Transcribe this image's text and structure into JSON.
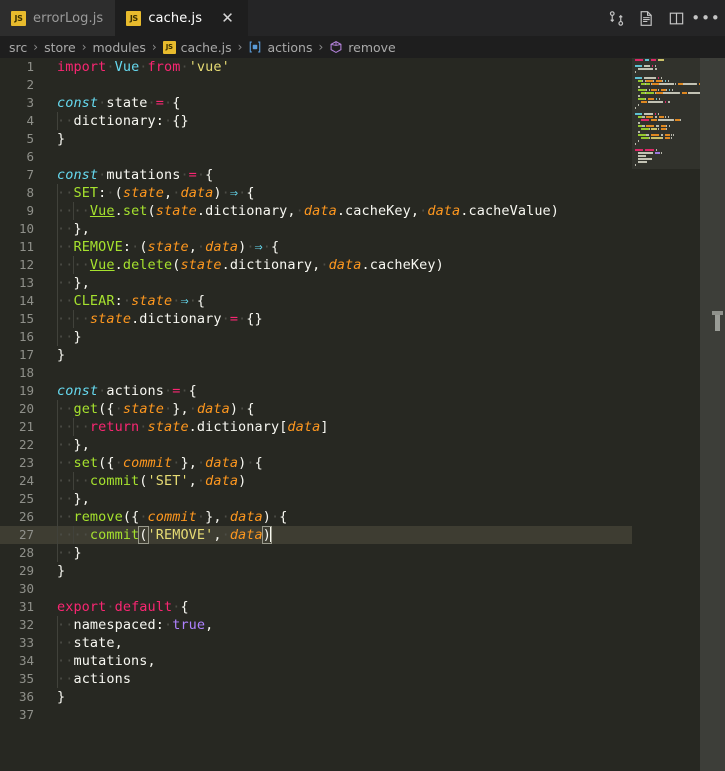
{
  "window": {
    "app": "Visual Studio Code",
    "theme": "Monokai Dark"
  },
  "tabbar": {
    "tabs": [
      {
        "label": "errorLog.js",
        "icon": "js-file-icon",
        "badge": "JS",
        "active": false,
        "closable": false
      },
      {
        "label": "cache.js",
        "icon": "js-file-icon",
        "badge": "JS",
        "active": true,
        "closable": true,
        "close_label": "✕"
      }
    ],
    "actions": [
      {
        "name": "split-diff-icon",
        "title": "Compare Changes"
      },
      {
        "name": "open-preview-icon",
        "title": "Open Preview"
      },
      {
        "name": "split-editor-icon",
        "title": "Split Editor Right"
      },
      {
        "name": "more-actions-icon",
        "title": "More Actions...",
        "glyph": "•••"
      }
    ]
  },
  "breadcrumbs": {
    "separator": "›",
    "items": [
      {
        "label": "src",
        "icon": "none"
      },
      {
        "label": "store",
        "icon": "none"
      },
      {
        "label": "modules",
        "icon": "none"
      },
      {
        "label": "cache.js",
        "icon": "js-file-icon",
        "badge": "JS"
      },
      {
        "label": "actions",
        "icon": "symbol-variable-icon"
      },
      {
        "label": "remove",
        "icon": "symbol-method-icon"
      }
    ]
  },
  "editor": {
    "language": "javascript",
    "active_line": 27,
    "cursor": {
      "line": 27,
      "column": 27
    },
    "total_lines": 37,
    "colors": {
      "background": "#272822",
      "active_line": "#3e3d32",
      "line_number": "#8f908a",
      "keyword": "#f92672",
      "string": "#e6db74",
      "function": "#a6e22e",
      "parameter": "#fd971f",
      "constant": "#66d9ef",
      "number": "#ae81ff",
      "text": "#f8f8f2"
    },
    "lines": [
      {
        "n": 1,
        "tokens": [
          {
            "t": "import",
            "c": "kw"
          },
          {
            "t": "·",
            "c": "ws"
          },
          {
            "t": "Vue",
            "c": "typ"
          },
          {
            "t": "·",
            "c": "ws"
          },
          {
            "t": "from",
            "c": "kw"
          },
          {
            "t": "·",
            "c": "ws"
          },
          {
            "t": "'vue'",
            "c": "str"
          }
        ]
      },
      {
        "n": 2,
        "tokens": []
      },
      {
        "n": 3,
        "tokens": [
          {
            "t": "const",
            "c": "cst"
          },
          {
            "t": "·",
            "c": "ws"
          },
          {
            "t": "state",
            "c": "plain"
          },
          {
            "t": "·",
            "c": "ws"
          },
          {
            "t": "=",
            "c": "op"
          },
          {
            "t": "·",
            "c": "ws"
          },
          {
            "t": "{",
            "c": "pun"
          }
        ]
      },
      {
        "n": 4,
        "indent": 1,
        "tokens": [
          {
            "t": "··",
            "c": "ws"
          },
          {
            "t": "dictionary:",
            "c": "plain"
          },
          {
            "t": "·",
            "c": "ws"
          },
          {
            "t": "{}",
            "c": "pun"
          }
        ]
      },
      {
        "n": 5,
        "tokens": [
          {
            "t": "}",
            "c": "pun"
          }
        ]
      },
      {
        "n": 6,
        "tokens": []
      },
      {
        "n": 7,
        "tokens": [
          {
            "t": "const",
            "c": "cst"
          },
          {
            "t": "·",
            "c": "ws"
          },
          {
            "t": "mutations",
            "c": "plain"
          },
          {
            "t": "·",
            "c": "ws"
          },
          {
            "t": "=",
            "c": "op"
          },
          {
            "t": "·",
            "c": "ws"
          },
          {
            "t": "{",
            "c": "pun"
          }
        ]
      },
      {
        "n": 8,
        "indent": 1,
        "tokens": [
          {
            "t": "··",
            "c": "ws"
          },
          {
            "t": "SET",
            "c": "fn"
          },
          {
            "t": ":",
            "c": "pun"
          },
          {
            "t": "·",
            "c": "ws"
          },
          {
            "t": "(",
            "c": "pun"
          },
          {
            "t": "state",
            "c": "prm"
          },
          {
            "t": ",",
            "c": "pun"
          },
          {
            "t": "·",
            "c": "ws"
          },
          {
            "t": "data",
            "c": "prm"
          },
          {
            "t": ")",
            "c": "pun"
          },
          {
            "t": "·",
            "c": "ws"
          },
          {
            "t": "⇒",
            "c": "arw"
          },
          {
            "t": "·",
            "c": "ws"
          },
          {
            "t": "{",
            "c": "pun"
          }
        ]
      },
      {
        "n": 9,
        "indent": 2,
        "tokens": [
          {
            "t": "····",
            "c": "ws"
          },
          {
            "t": "Vue",
            "c": "typ-u"
          },
          {
            "t": ".",
            "c": "pun"
          },
          {
            "t": "set",
            "c": "fn"
          },
          {
            "t": "(",
            "c": "pun"
          },
          {
            "t": "state",
            "c": "prm"
          },
          {
            "t": ".dictionary",
            "c": "plain"
          },
          {
            "t": ",",
            "c": "pun"
          },
          {
            "t": "·",
            "c": "ws"
          },
          {
            "t": "data",
            "c": "prm"
          },
          {
            "t": ".cacheKey",
            "c": "plain"
          },
          {
            "t": ",",
            "c": "pun"
          },
          {
            "t": "·",
            "c": "ws"
          },
          {
            "t": "data",
            "c": "prm"
          },
          {
            "t": ".cacheValue",
            "c": "plain"
          },
          {
            "t": ")",
            "c": "pun"
          }
        ]
      },
      {
        "n": 10,
        "indent": 1,
        "tokens": [
          {
            "t": "··",
            "c": "ws"
          },
          {
            "t": "},",
            "c": "pun"
          }
        ]
      },
      {
        "n": 11,
        "indent": 1,
        "tokens": [
          {
            "t": "··",
            "c": "ws"
          },
          {
            "t": "REMOVE",
            "c": "fn"
          },
          {
            "t": ":",
            "c": "pun"
          },
          {
            "t": "·",
            "c": "ws"
          },
          {
            "t": "(",
            "c": "pun"
          },
          {
            "t": "state",
            "c": "prm"
          },
          {
            "t": ",",
            "c": "pun"
          },
          {
            "t": "·",
            "c": "ws"
          },
          {
            "t": "data",
            "c": "prm"
          },
          {
            "t": ")",
            "c": "pun"
          },
          {
            "t": "·",
            "c": "ws"
          },
          {
            "t": "⇒",
            "c": "arw"
          },
          {
            "t": "·",
            "c": "ws"
          },
          {
            "t": "{",
            "c": "pun"
          }
        ]
      },
      {
        "n": 12,
        "indent": 2,
        "tokens": [
          {
            "t": "····",
            "c": "ws"
          },
          {
            "t": "Vue",
            "c": "typ-u"
          },
          {
            "t": ".",
            "c": "pun"
          },
          {
            "t": "delete",
            "c": "fn"
          },
          {
            "t": "(",
            "c": "pun"
          },
          {
            "t": "state",
            "c": "prm"
          },
          {
            "t": ".dictionary",
            "c": "plain"
          },
          {
            "t": ",",
            "c": "pun"
          },
          {
            "t": "·",
            "c": "ws"
          },
          {
            "t": "data",
            "c": "prm"
          },
          {
            "t": ".cacheKey",
            "c": "plain"
          },
          {
            "t": ")",
            "c": "pun"
          }
        ]
      },
      {
        "n": 13,
        "indent": 1,
        "tokens": [
          {
            "t": "··",
            "c": "ws"
          },
          {
            "t": "},",
            "c": "pun"
          }
        ]
      },
      {
        "n": 14,
        "indent": 1,
        "tokens": [
          {
            "t": "··",
            "c": "ws"
          },
          {
            "t": "CLEAR",
            "c": "fn"
          },
          {
            "t": ":",
            "c": "pun"
          },
          {
            "t": "·",
            "c": "ws"
          },
          {
            "t": "state",
            "c": "prm"
          },
          {
            "t": "·",
            "c": "ws"
          },
          {
            "t": "⇒",
            "c": "arw"
          },
          {
            "t": "·",
            "c": "ws"
          },
          {
            "t": "{",
            "c": "pun"
          }
        ]
      },
      {
        "n": 15,
        "indent": 2,
        "tokens": [
          {
            "t": "····",
            "c": "ws"
          },
          {
            "t": "state",
            "c": "prm"
          },
          {
            "t": ".dictionary",
            "c": "plain"
          },
          {
            "t": "·",
            "c": "ws"
          },
          {
            "t": "=",
            "c": "op"
          },
          {
            "t": "·",
            "c": "ws"
          },
          {
            "t": "{}",
            "c": "pun"
          }
        ]
      },
      {
        "n": 16,
        "indent": 1,
        "tokens": [
          {
            "t": "··",
            "c": "ws"
          },
          {
            "t": "}",
            "c": "pun"
          }
        ]
      },
      {
        "n": 17,
        "tokens": [
          {
            "t": "}",
            "c": "pun"
          }
        ]
      },
      {
        "n": 18,
        "tokens": []
      },
      {
        "n": 19,
        "tokens": [
          {
            "t": "const",
            "c": "cst"
          },
          {
            "t": "·",
            "c": "ws"
          },
          {
            "t": "actions",
            "c": "plain"
          },
          {
            "t": "·",
            "c": "ws"
          },
          {
            "t": "=",
            "c": "op"
          },
          {
            "t": "·",
            "c": "ws"
          },
          {
            "t": "{",
            "c": "pun"
          }
        ]
      },
      {
        "n": 20,
        "indent": 1,
        "tokens": [
          {
            "t": "··",
            "c": "ws"
          },
          {
            "t": "get",
            "c": "fn"
          },
          {
            "t": "({",
            "c": "pun"
          },
          {
            "t": "·",
            "c": "ws"
          },
          {
            "t": "state",
            "c": "prm"
          },
          {
            "t": "·",
            "c": "ws"
          },
          {
            "t": "},",
            "c": "pun"
          },
          {
            "t": "·",
            "c": "ws"
          },
          {
            "t": "data",
            "c": "prm"
          },
          {
            "t": ")",
            "c": "pun"
          },
          {
            "t": "·",
            "c": "ws"
          },
          {
            "t": "{",
            "c": "pun"
          }
        ]
      },
      {
        "n": 21,
        "indent": 2,
        "tokens": [
          {
            "t": "····",
            "c": "ws"
          },
          {
            "t": "return",
            "c": "kw"
          },
          {
            "t": "·",
            "c": "ws"
          },
          {
            "t": "state",
            "c": "prm"
          },
          {
            "t": ".dictionary",
            "c": "plain"
          },
          {
            "t": "[",
            "c": "pun"
          },
          {
            "t": "data",
            "c": "prm"
          },
          {
            "t": "]",
            "c": "pun"
          }
        ]
      },
      {
        "n": 22,
        "indent": 1,
        "tokens": [
          {
            "t": "··",
            "c": "ws"
          },
          {
            "t": "},",
            "c": "pun"
          }
        ]
      },
      {
        "n": 23,
        "indent": 1,
        "tokens": [
          {
            "t": "··",
            "c": "ws"
          },
          {
            "t": "set",
            "c": "fn"
          },
          {
            "t": "({",
            "c": "pun"
          },
          {
            "t": "·",
            "c": "ws"
          },
          {
            "t": "commit",
            "c": "prm"
          },
          {
            "t": "·",
            "c": "ws"
          },
          {
            "t": "},",
            "c": "pun"
          },
          {
            "t": "·",
            "c": "ws"
          },
          {
            "t": "data",
            "c": "prm"
          },
          {
            "t": ")",
            "c": "pun"
          },
          {
            "t": "·",
            "c": "ws"
          },
          {
            "t": "{",
            "c": "pun"
          }
        ]
      },
      {
        "n": 24,
        "indent": 2,
        "tokens": [
          {
            "t": "····",
            "c": "ws"
          },
          {
            "t": "commit",
            "c": "fn"
          },
          {
            "t": "(",
            "c": "pun"
          },
          {
            "t": "'SET'",
            "c": "str"
          },
          {
            "t": ",",
            "c": "pun"
          },
          {
            "t": "·",
            "c": "ws"
          },
          {
            "t": "data",
            "c": "prm"
          },
          {
            "t": ")",
            "c": "pun"
          }
        ]
      },
      {
        "n": 25,
        "indent": 1,
        "tokens": [
          {
            "t": "··",
            "c": "ws"
          },
          {
            "t": "},",
            "c": "pun"
          }
        ]
      },
      {
        "n": 26,
        "indent": 1,
        "tokens": [
          {
            "t": "··",
            "c": "ws"
          },
          {
            "t": "remove",
            "c": "fn"
          },
          {
            "t": "({",
            "c": "pun"
          },
          {
            "t": "·",
            "c": "ws"
          },
          {
            "t": "commit",
            "c": "prm"
          },
          {
            "t": "·",
            "c": "ws"
          },
          {
            "t": "},",
            "c": "pun"
          },
          {
            "t": "·",
            "c": "ws"
          },
          {
            "t": "data",
            "c": "prm"
          },
          {
            "t": ")",
            "c": "pun"
          },
          {
            "t": "·",
            "c": "ws"
          },
          {
            "t": "{",
            "c": "pun"
          }
        ]
      },
      {
        "n": 27,
        "indent": 2,
        "active": true,
        "tokens": [
          {
            "t": "····",
            "c": "ws"
          },
          {
            "t": "commit",
            "c": "fn"
          },
          {
            "t": "(",
            "c": "pun",
            "bracket_match": true
          },
          {
            "t": "'REMOVE'",
            "c": "str"
          },
          {
            "t": ",",
            "c": "pun"
          },
          {
            "t": "·",
            "c": "ws"
          },
          {
            "t": "data",
            "c": "prm"
          },
          {
            "t": ")",
            "c": "pun",
            "bracket_match": true
          },
          {
            "t": "",
            "c": "cursor"
          }
        ]
      },
      {
        "n": 28,
        "indent": 1,
        "tokens": [
          {
            "t": "··",
            "c": "ws"
          },
          {
            "t": "}",
            "c": "pun"
          }
        ]
      },
      {
        "n": 29,
        "tokens": [
          {
            "t": "}",
            "c": "pun"
          }
        ]
      },
      {
        "n": 30,
        "tokens": []
      },
      {
        "n": 31,
        "tokens": [
          {
            "t": "export",
            "c": "kw"
          },
          {
            "t": "·",
            "c": "ws"
          },
          {
            "t": "default",
            "c": "kw"
          },
          {
            "t": "·",
            "c": "ws"
          },
          {
            "t": "{",
            "c": "pun"
          }
        ]
      },
      {
        "n": 32,
        "indent": 1,
        "tokens": [
          {
            "t": "··",
            "c": "ws"
          },
          {
            "t": "namespaced:",
            "c": "plain"
          },
          {
            "t": "·",
            "c": "ws"
          },
          {
            "t": "true",
            "c": "num"
          },
          {
            "t": ",",
            "c": "pun"
          }
        ]
      },
      {
        "n": 33,
        "indent": 1,
        "tokens": [
          {
            "t": "··",
            "c": "ws"
          },
          {
            "t": "state,",
            "c": "plain"
          }
        ]
      },
      {
        "n": 34,
        "indent": 1,
        "tokens": [
          {
            "t": "··",
            "c": "ws"
          },
          {
            "t": "mutations,",
            "c": "plain"
          }
        ]
      },
      {
        "n": 35,
        "indent": 1,
        "tokens": [
          {
            "t": "··",
            "c": "ws"
          },
          {
            "t": "actions",
            "c": "plain"
          }
        ]
      },
      {
        "n": 36,
        "tokens": [
          {
            "t": "}",
            "c": "pun"
          }
        ]
      },
      {
        "n": 37,
        "tokens": []
      }
    ]
  },
  "minimap": {
    "name": "minimap",
    "visible": true
  },
  "overview_ruler": {
    "name": "overview-ruler",
    "visible": true
  }
}
